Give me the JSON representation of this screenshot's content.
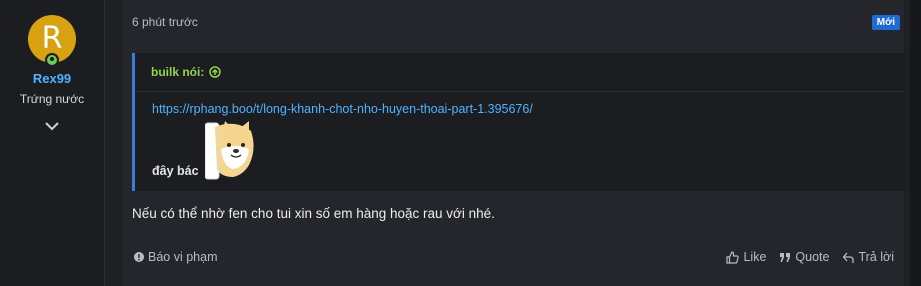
{
  "user": {
    "avatar_letter": "R",
    "name": "Rex99",
    "title": "Trứng nước"
  },
  "post": {
    "time": "6 phút trước",
    "badge": "Mới",
    "quote": {
      "author_line": "builk nói:",
      "link": "https://rphang.boo/t/long-khanh-chot-nho-huyen-thoai-part-1.395676/",
      "text": "đây bác"
    },
    "message": "Nếu có thể nhờ fen cho tui xin số em hàng hoặc rau với nhé."
  },
  "actions": {
    "report": "Báo vi phạm",
    "like": "Like",
    "quote": "Quote",
    "reply": "Trả lời"
  },
  "colors": {
    "accent": "#4fb3ff",
    "quote_author": "#8fd64a",
    "badge": "#1f6bd6",
    "avatar": "#d7a112"
  }
}
